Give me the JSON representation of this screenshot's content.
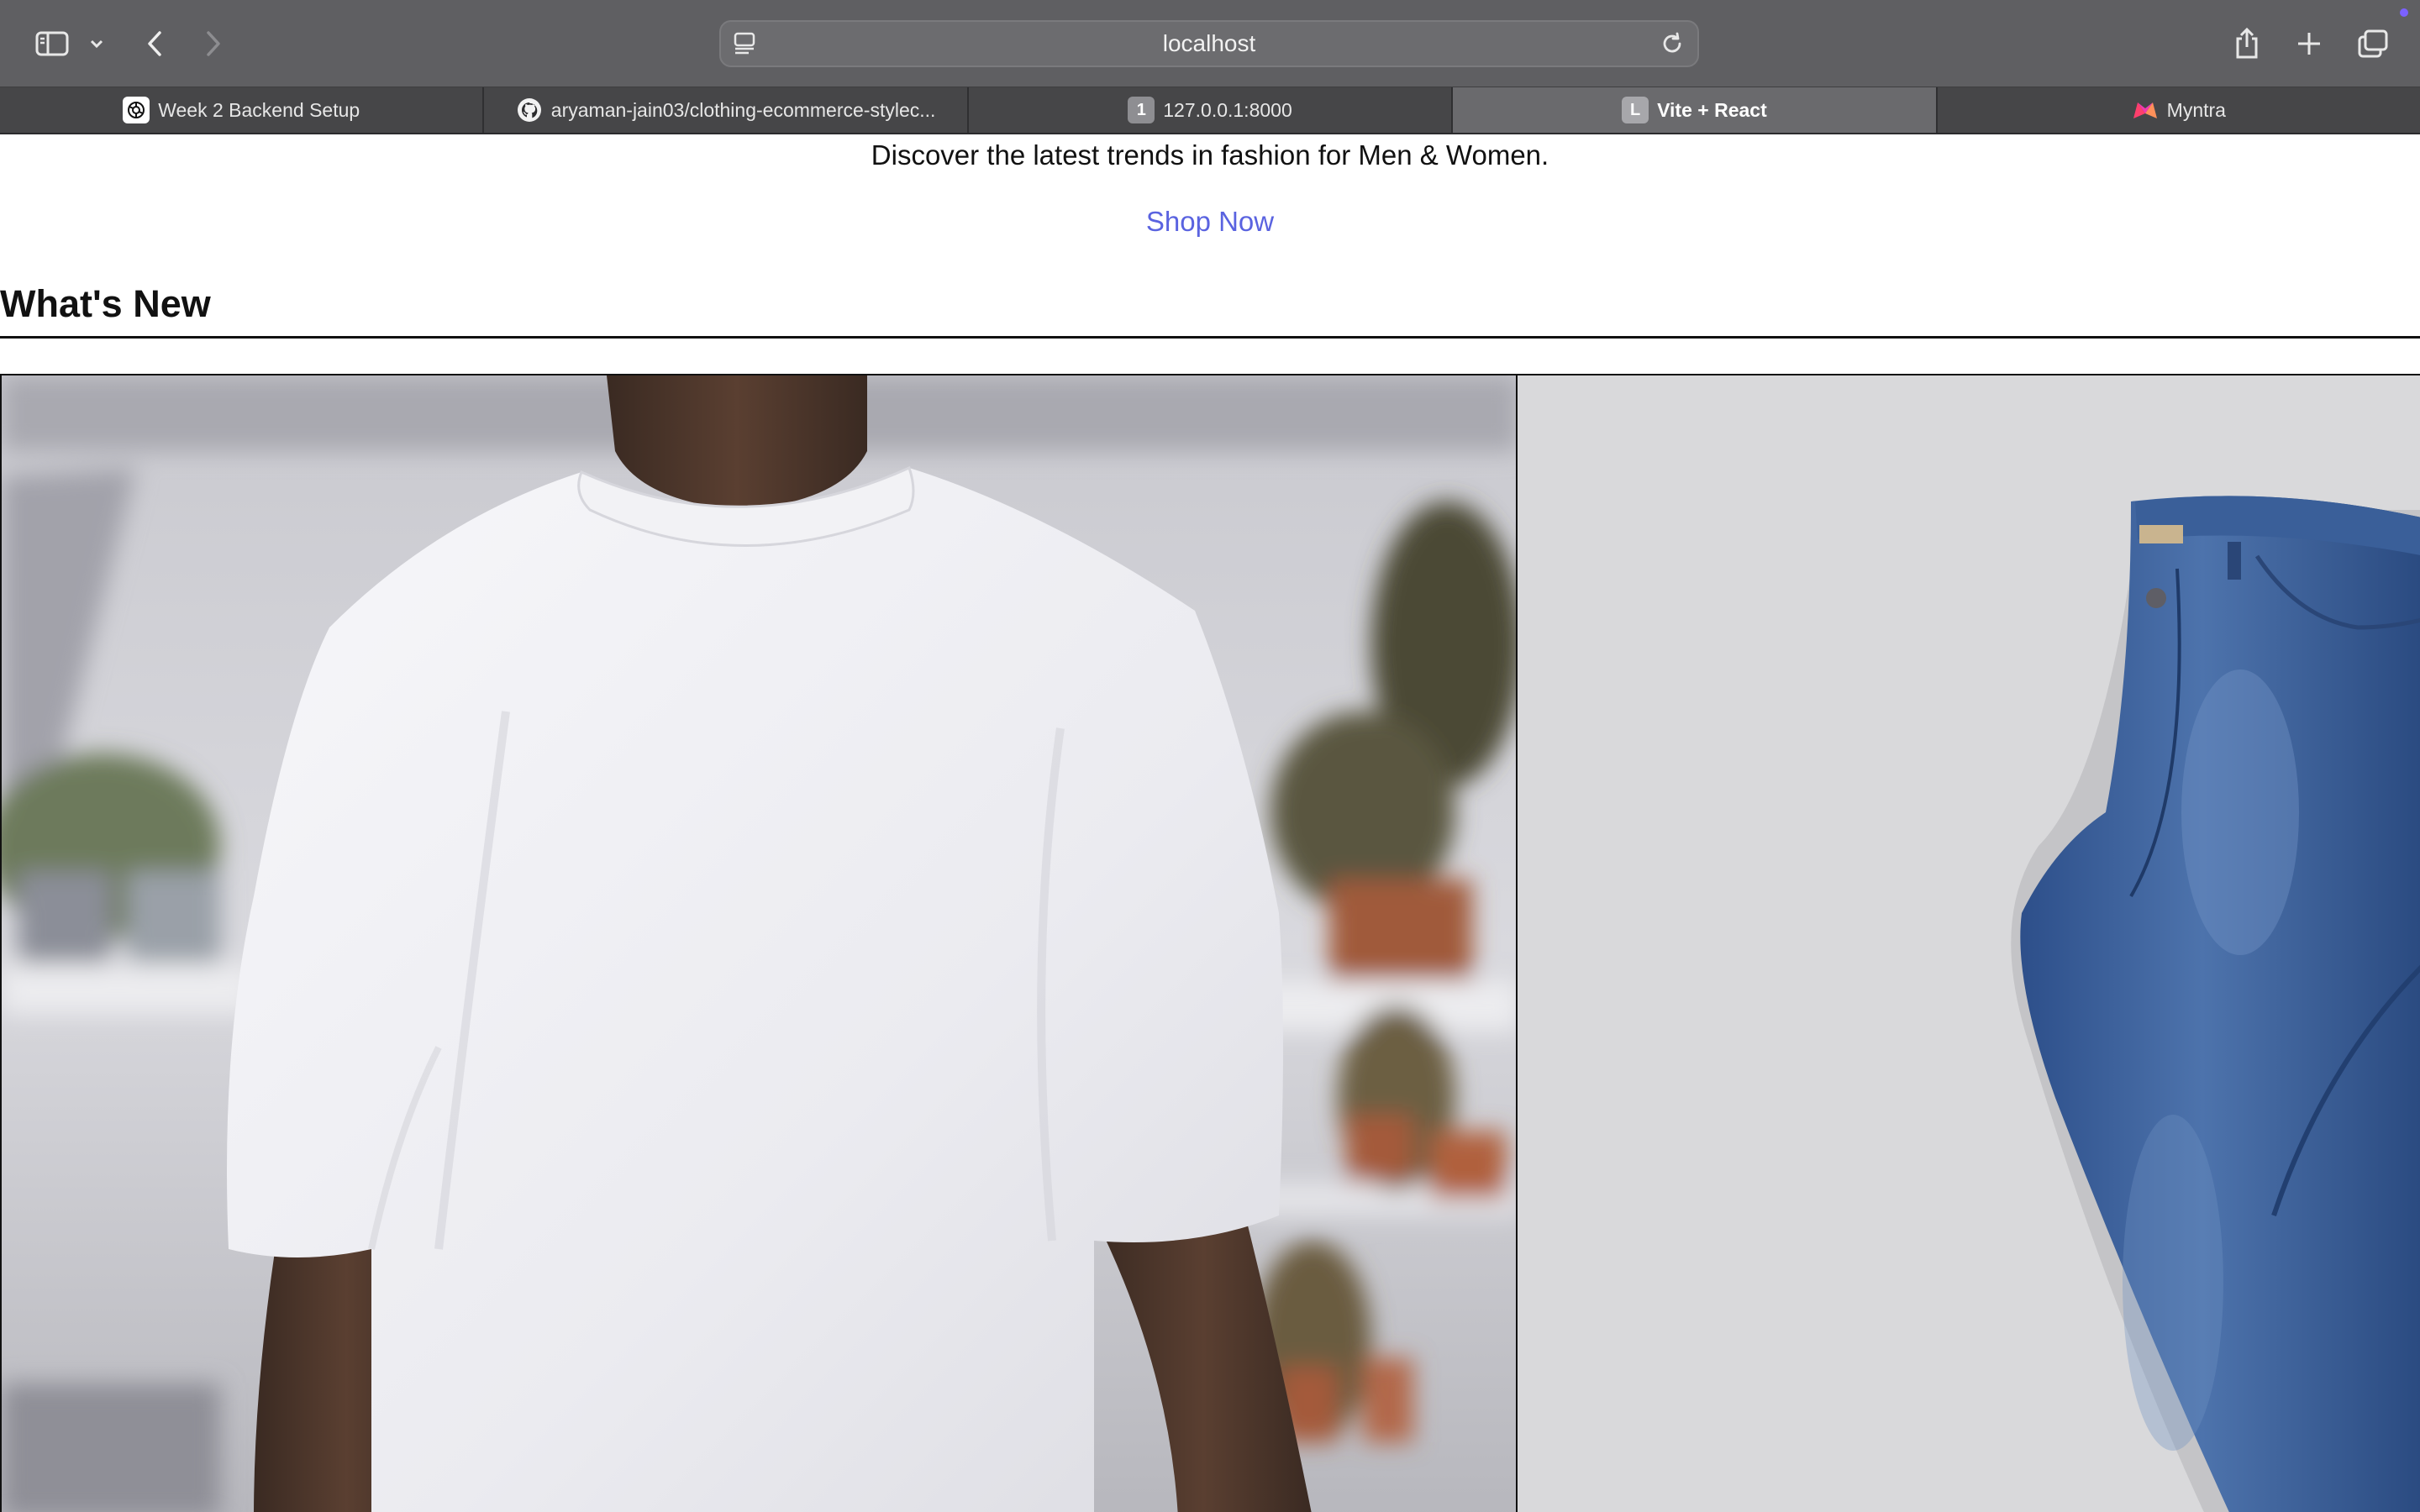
{
  "toolbar": {
    "url": "localhost",
    "icons": [
      "sidebar-icon",
      "chevron-down-icon",
      "back-icon",
      "forward-icon",
      "reader-icon",
      "reload-icon",
      "share-icon",
      "plus-icon",
      "tabs-overview-icon"
    ]
  },
  "tabs": [
    {
      "label": "Week 2 Backend Setup",
      "favicon": "openai-icon",
      "active": false
    },
    {
      "label": "aryaman-jain03/clothing-ecommerce-stylec...",
      "favicon": "github-icon",
      "active": false
    },
    {
      "label": "127.0.0.1:8000",
      "favicon_text": "1",
      "active": false
    },
    {
      "label": "Vite + React",
      "favicon_text": "L",
      "active": true
    },
    {
      "label": "Myntra",
      "favicon": "myntra-icon",
      "active": false
    }
  ],
  "hero": {
    "subtitle": "Discover the latest trends in fashion for Men & Women.",
    "cta": "Shop Now"
  },
  "section": {
    "title": "What's New"
  },
  "products": [
    {
      "image": "white-tshirt-photo"
    },
    {
      "image": "blue-jeans-photo"
    }
  ],
  "colors": {
    "toolbar_bg": "#5f5f62",
    "tab_active_bg": "#6a6a6d",
    "link": "#5a63e0",
    "text": "#111111"
  }
}
